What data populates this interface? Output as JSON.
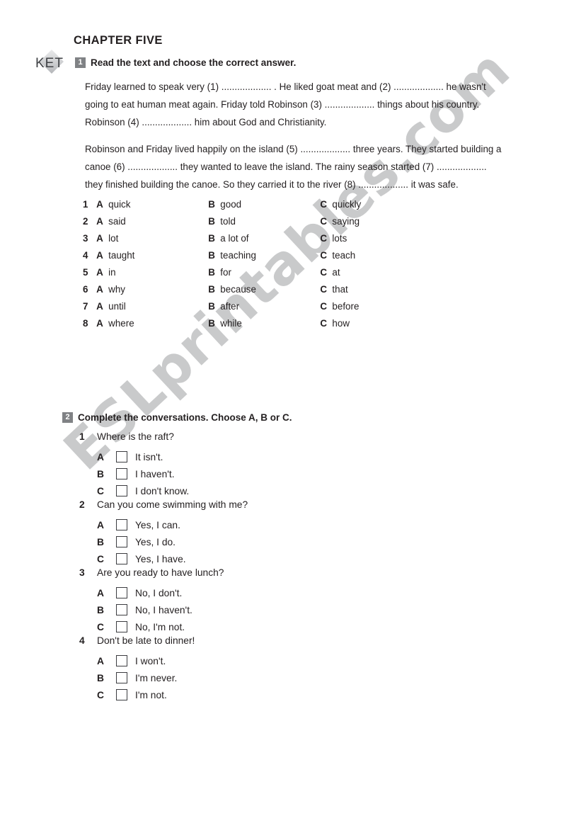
{
  "document": {
    "chapter_title": "CHAPTER FIVE",
    "logo_text": "KET",
    "watermark": "ESLprintables.com"
  },
  "exercise1": {
    "number": "1",
    "instruction": "Read the text and choose the correct answer.",
    "paragraphs": [
      "Friday learned to speak very (1) ................... . He liked goat meat and (2) ................... he wasn't going to eat human meat again. Friday told Robinson (3) ................... things about his country. Robinson (4) ................... him about God and Christianity.",
      "Robinson and Friday lived happily on the island (5) ................... three years. They started building a canoe (6) ................... they wanted to leave the island. The rainy season started (7) ................... they finished building the canoe. So they carried it to the river (8) ................... it was safe."
    ],
    "option_labels": [
      "A",
      "B",
      "C"
    ],
    "options": [
      {
        "num": "1",
        "a": "quick",
        "b": "good",
        "c": "quickly"
      },
      {
        "num": "2",
        "a": "said",
        "b": "told",
        "c": "saying"
      },
      {
        "num": "3",
        "a": "lot",
        "b": "a lot of",
        "c": "lots"
      },
      {
        "num": "4",
        "a": "taught",
        "b": "teaching",
        "c": "teach"
      },
      {
        "num": "5",
        "a": "in",
        "b": "for",
        "c": "at"
      },
      {
        "num": "6",
        "a": "why",
        "b": "because",
        "c": "that"
      },
      {
        "num": "7",
        "a": "until",
        "b": "after",
        "c": "before"
      },
      {
        "num": "8",
        "a": "where",
        "b": "while",
        "c": "how"
      }
    ]
  },
  "exercise2": {
    "number": "2",
    "instruction": "Complete the conversations. Choose A, B or C.",
    "questions": [
      {
        "num": "1",
        "prompt": "Where is the raft?",
        "answers": [
          {
            "letter": "A",
            "text": "It isn't.",
            "checked": false
          },
          {
            "letter": "B",
            "text": "I haven't.",
            "checked": false
          },
          {
            "letter": "C",
            "text": "I don't know.",
            "checked": false
          }
        ]
      },
      {
        "num": "2",
        "prompt": "Can you come swimming with me?",
        "answers": [
          {
            "letter": "A",
            "text": "Yes, I can.",
            "checked": false
          },
          {
            "letter": "B",
            "text": "Yes, I do.",
            "checked": false
          },
          {
            "letter": "C",
            "text": "Yes, I have.",
            "checked": false
          }
        ]
      },
      {
        "num": "3",
        "prompt": "Are you ready to have lunch?",
        "answers": [
          {
            "letter": "A",
            "text": "No, I don't.",
            "checked": false
          },
          {
            "letter": "B",
            "text": "No, I haven't.",
            "checked": false
          },
          {
            "letter": "C",
            "text": "No, I'm not.",
            "checked": false
          }
        ]
      },
      {
        "num": "4",
        "prompt": "Don't be late to dinner!",
        "answers": [
          {
            "letter": "A",
            "text": "I won't.",
            "checked": false
          },
          {
            "letter": "B",
            "text": "I'm never.",
            "checked": false
          },
          {
            "letter": "C",
            "text": "I'm not.",
            "checked": false
          }
        ]
      }
    ]
  },
  "colors": {
    "text": "#231f20",
    "badge_bg": "#808285",
    "watermark": "#c9cacb",
    "checkbox_border": "#3b3c40"
  }
}
